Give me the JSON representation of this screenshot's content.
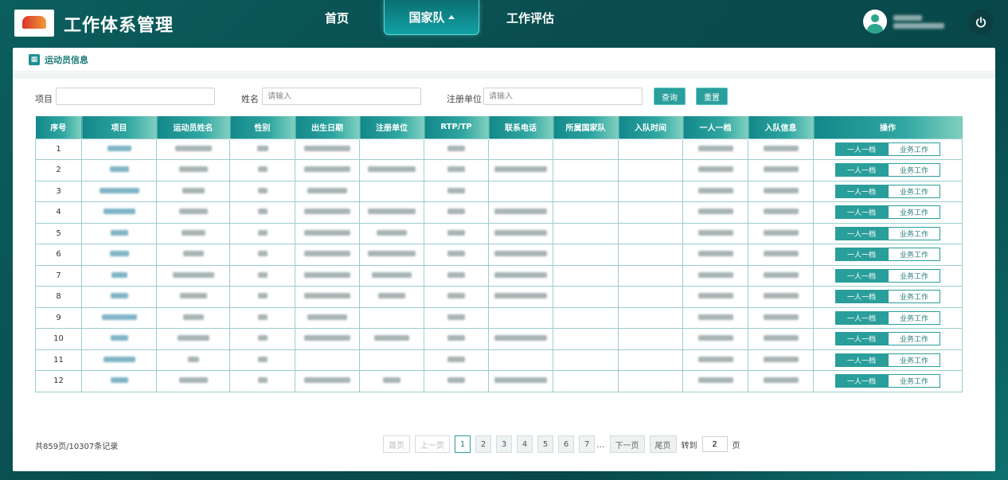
{
  "header": {
    "title": "工作体系管理",
    "nav": [
      {
        "label": "首页"
      },
      {
        "label": "国家队"
      },
      {
        "label": "工作评估"
      }
    ]
  },
  "breadcrumb": {
    "label": "运动员信息"
  },
  "filters": {
    "project_label": "项目",
    "project_value": "",
    "name_label": "姓名",
    "name_placeholder": "请输入",
    "unit_label": "注册单位",
    "unit_placeholder": "请输入",
    "query_btn": "查询",
    "reset_btn": "重置"
  },
  "table": {
    "columns": [
      "序号",
      "项目",
      "运动员姓名",
      "性别",
      "出生日期",
      "注册单位",
      "RTP/TP",
      "联系电话",
      "所属国家队",
      "入队时间",
      "一人一档",
      "入队信息",
      "操作"
    ],
    "rows": [
      {
        "no": "1"
      },
      {
        "no": "2"
      },
      {
        "no": "3"
      },
      {
        "no": "4"
      },
      {
        "no": "5"
      },
      {
        "no": "6"
      },
      {
        "no": "7"
      },
      {
        "no": "8"
      },
      {
        "no": "9"
      },
      {
        "no": "10"
      },
      {
        "no": "11"
      },
      {
        "no": "12"
      }
    ],
    "op_a": "一人一档",
    "op_b": "业务工作"
  },
  "pagination": {
    "total": "共859页/10307条记录",
    "first": "首页",
    "prev": "上一页",
    "pages": [
      "1",
      "2",
      "3",
      "4",
      "5",
      "6",
      "7"
    ],
    "current": "1",
    "ellipsis": "...",
    "next": "下一页",
    "last": "尾页",
    "goto_label": "转到",
    "goto_value": "2",
    "goto_unit": "页"
  },
  "colors": {
    "accent": "#2a9e9b",
    "header_bg": "#0a4d4f"
  },
  "icons": {
    "power": "power-icon",
    "avatar": "user-avatar-icon",
    "breadcrumb": "table-icon"
  }
}
